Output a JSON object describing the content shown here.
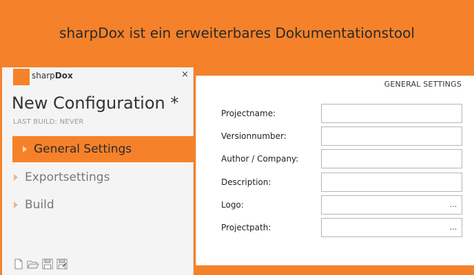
{
  "banner": {
    "text": "sharpDox ist ein erweiterbares Dokumentationstool"
  },
  "app": {
    "brand_plain": "sharp",
    "brand_bold": "Dox",
    "close_symbol": "×"
  },
  "config": {
    "title": "New Configuration *",
    "last_build": "LAST BUILD: NEVER"
  },
  "nav": {
    "items": [
      {
        "label": "General Settings",
        "active": true
      },
      {
        "label": "Exportsettings",
        "active": false
      },
      {
        "label": "Build",
        "active": false
      }
    ]
  },
  "toolbar": {
    "icons": [
      "new-file-icon",
      "open-folder-icon",
      "save-icon",
      "save-as-icon"
    ]
  },
  "settings": {
    "header": "GENERAL SETTINGS",
    "fields": [
      {
        "label": "Projectname:",
        "value": "",
        "has_browse": false
      },
      {
        "label": "Versionnumber:",
        "value": "",
        "has_browse": false
      },
      {
        "label": "Author / Company:",
        "value": "",
        "has_browse": false
      },
      {
        "label": "Description:",
        "value": "",
        "has_browse": false
      },
      {
        "label": "Logo:",
        "value": "",
        "has_browse": true,
        "browse_label": "..."
      },
      {
        "label": "Projectpath:",
        "value": "",
        "has_browse": true,
        "browse_label": "..."
      }
    ]
  },
  "colors": {
    "accent": "#f5822a",
    "panel": "#f4f4f4",
    "text": "#333333"
  }
}
